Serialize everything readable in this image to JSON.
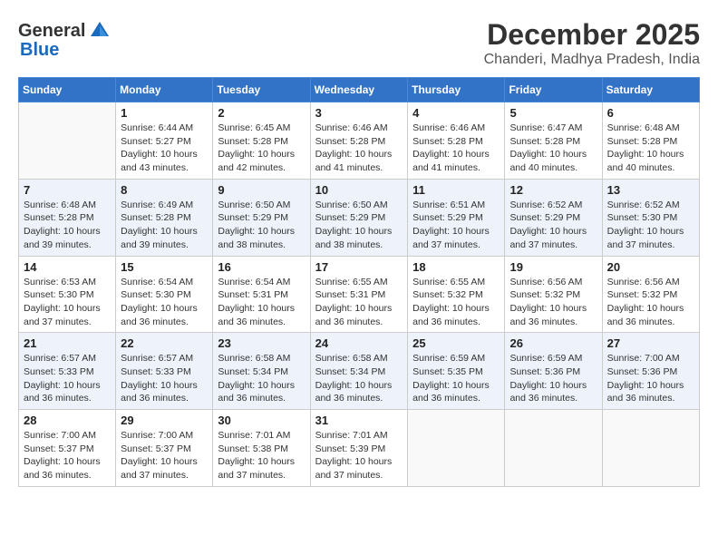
{
  "header": {
    "logo_general": "General",
    "logo_blue": "Blue",
    "month": "December 2025",
    "location": "Chanderi, Madhya Pradesh, India"
  },
  "days_of_week": [
    "Sunday",
    "Monday",
    "Tuesday",
    "Wednesday",
    "Thursday",
    "Friday",
    "Saturday"
  ],
  "weeks": [
    [
      {
        "day": "",
        "sunrise": "",
        "sunset": "",
        "daylight": ""
      },
      {
        "day": "1",
        "sunrise": "Sunrise: 6:44 AM",
        "sunset": "Sunset: 5:27 PM",
        "daylight": "Daylight: 10 hours and 43 minutes."
      },
      {
        "day": "2",
        "sunrise": "Sunrise: 6:45 AM",
        "sunset": "Sunset: 5:28 PM",
        "daylight": "Daylight: 10 hours and 42 minutes."
      },
      {
        "day": "3",
        "sunrise": "Sunrise: 6:46 AM",
        "sunset": "Sunset: 5:28 PM",
        "daylight": "Daylight: 10 hours and 41 minutes."
      },
      {
        "day": "4",
        "sunrise": "Sunrise: 6:46 AM",
        "sunset": "Sunset: 5:28 PM",
        "daylight": "Daylight: 10 hours and 41 minutes."
      },
      {
        "day": "5",
        "sunrise": "Sunrise: 6:47 AM",
        "sunset": "Sunset: 5:28 PM",
        "daylight": "Daylight: 10 hours and 40 minutes."
      },
      {
        "day": "6",
        "sunrise": "Sunrise: 6:48 AM",
        "sunset": "Sunset: 5:28 PM",
        "daylight": "Daylight: 10 hours and 40 minutes."
      }
    ],
    [
      {
        "day": "7",
        "sunrise": "Sunrise: 6:48 AM",
        "sunset": "Sunset: 5:28 PM",
        "daylight": "Daylight: 10 hours and 39 minutes."
      },
      {
        "day": "8",
        "sunrise": "Sunrise: 6:49 AM",
        "sunset": "Sunset: 5:28 PM",
        "daylight": "Daylight: 10 hours and 39 minutes."
      },
      {
        "day": "9",
        "sunrise": "Sunrise: 6:50 AM",
        "sunset": "Sunset: 5:29 PM",
        "daylight": "Daylight: 10 hours and 38 minutes."
      },
      {
        "day": "10",
        "sunrise": "Sunrise: 6:50 AM",
        "sunset": "Sunset: 5:29 PM",
        "daylight": "Daylight: 10 hours and 38 minutes."
      },
      {
        "day": "11",
        "sunrise": "Sunrise: 6:51 AM",
        "sunset": "Sunset: 5:29 PM",
        "daylight": "Daylight: 10 hours and 37 minutes."
      },
      {
        "day": "12",
        "sunrise": "Sunrise: 6:52 AM",
        "sunset": "Sunset: 5:29 PM",
        "daylight": "Daylight: 10 hours and 37 minutes."
      },
      {
        "day": "13",
        "sunrise": "Sunrise: 6:52 AM",
        "sunset": "Sunset: 5:30 PM",
        "daylight": "Daylight: 10 hours and 37 minutes."
      }
    ],
    [
      {
        "day": "14",
        "sunrise": "Sunrise: 6:53 AM",
        "sunset": "Sunset: 5:30 PM",
        "daylight": "Daylight: 10 hours and 37 minutes."
      },
      {
        "day": "15",
        "sunrise": "Sunrise: 6:54 AM",
        "sunset": "Sunset: 5:30 PM",
        "daylight": "Daylight: 10 hours and 36 minutes."
      },
      {
        "day": "16",
        "sunrise": "Sunrise: 6:54 AM",
        "sunset": "Sunset: 5:31 PM",
        "daylight": "Daylight: 10 hours and 36 minutes."
      },
      {
        "day": "17",
        "sunrise": "Sunrise: 6:55 AM",
        "sunset": "Sunset: 5:31 PM",
        "daylight": "Daylight: 10 hours and 36 minutes."
      },
      {
        "day": "18",
        "sunrise": "Sunrise: 6:55 AM",
        "sunset": "Sunset: 5:32 PM",
        "daylight": "Daylight: 10 hours and 36 minutes."
      },
      {
        "day": "19",
        "sunrise": "Sunrise: 6:56 AM",
        "sunset": "Sunset: 5:32 PM",
        "daylight": "Daylight: 10 hours and 36 minutes."
      },
      {
        "day": "20",
        "sunrise": "Sunrise: 6:56 AM",
        "sunset": "Sunset: 5:32 PM",
        "daylight": "Daylight: 10 hours and 36 minutes."
      }
    ],
    [
      {
        "day": "21",
        "sunrise": "Sunrise: 6:57 AM",
        "sunset": "Sunset: 5:33 PM",
        "daylight": "Daylight: 10 hours and 36 minutes."
      },
      {
        "day": "22",
        "sunrise": "Sunrise: 6:57 AM",
        "sunset": "Sunset: 5:33 PM",
        "daylight": "Daylight: 10 hours and 36 minutes."
      },
      {
        "day": "23",
        "sunrise": "Sunrise: 6:58 AM",
        "sunset": "Sunset: 5:34 PM",
        "daylight": "Daylight: 10 hours and 36 minutes."
      },
      {
        "day": "24",
        "sunrise": "Sunrise: 6:58 AM",
        "sunset": "Sunset: 5:34 PM",
        "daylight": "Daylight: 10 hours and 36 minutes."
      },
      {
        "day": "25",
        "sunrise": "Sunrise: 6:59 AM",
        "sunset": "Sunset: 5:35 PM",
        "daylight": "Daylight: 10 hours and 36 minutes."
      },
      {
        "day": "26",
        "sunrise": "Sunrise: 6:59 AM",
        "sunset": "Sunset: 5:36 PM",
        "daylight": "Daylight: 10 hours and 36 minutes."
      },
      {
        "day": "27",
        "sunrise": "Sunrise: 7:00 AM",
        "sunset": "Sunset: 5:36 PM",
        "daylight": "Daylight: 10 hours and 36 minutes."
      }
    ],
    [
      {
        "day": "28",
        "sunrise": "Sunrise: 7:00 AM",
        "sunset": "Sunset: 5:37 PM",
        "daylight": "Daylight: 10 hours and 36 minutes."
      },
      {
        "day": "29",
        "sunrise": "Sunrise: 7:00 AM",
        "sunset": "Sunset: 5:37 PM",
        "daylight": "Daylight: 10 hours and 37 minutes."
      },
      {
        "day": "30",
        "sunrise": "Sunrise: 7:01 AM",
        "sunset": "Sunset: 5:38 PM",
        "daylight": "Daylight: 10 hours and 37 minutes."
      },
      {
        "day": "31",
        "sunrise": "Sunrise: 7:01 AM",
        "sunset": "Sunset: 5:39 PM",
        "daylight": "Daylight: 10 hours and 37 minutes."
      },
      {
        "day": "",
        "sunrise": "",
        "sunset": "",
        "daylight": ""
      },
      {
        "day": "",
        "sunrise": "",
        "sunset": "",
        "daylight": ""
      },
      {
        "day": "",
        "sunrise": "",
        "sunset": "",
        "daylight": ""
      }
    ]
  ]
}
